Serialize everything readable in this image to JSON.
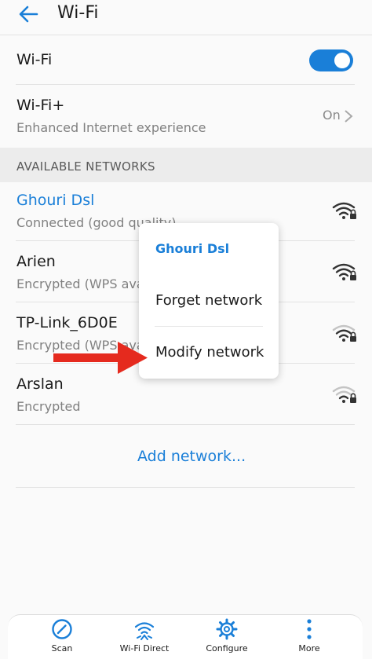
{
  "header": {
    "title": "Wi-Fi"
  },
  "wifi_row": {
    "label": "Wi-Fi",
    "enabled": true
  },
  "wifi_plus": {
    "label": "Wi-Fi+",
    "subtitle": "Enhanced Internet experience",
    "status": "On"
  },
  "section": {
    "label": "AVAILABLE NETWORKS"
  },
  "networks": [
    {
      "name": "Ghouri Dsl",
      "status": "Connected (good quality)",
      "signal_icon": "wifi-lock-icon"
    },
    {
      "name": "Arien",
      "status": "Encrypted (WPS available)",
      "signal_icon": "wifi-lock-icon"
    },
    {
      "name": "TP-Link_6D0E",
      "status": "Encrypted (WPS available)",
      "signal_icon": "wifi-lock-icon"
    },
    {
      "name": "Arslan",
      "status": "Encrypted",
      "signal_icon": "wifi-lock-icon"
    }
  ],
  "add_network": "Add network...",
  "context_menu": {
    "title": "Ghouri Dsl",
    "items": [
      "Forget network",
      "Modify network"
    ]
  },
  "bottom_nav": [
    {
      "label": "Scan",
      "icon": "scan-icon"
    },
    {
      "label": "Wi-Fi Direct",
      "icon": "wifi-direct-icon"
    },
    {
      "label": "Configure",
      "icon": "gear-icon"
    },
    {
      "label": "More",
      "icon": "more-vert-icon"
    }
  ],
  "colors": {
    "accent": "#1a7fd8",
    "arrow": "#e52a1e"
  }
}
